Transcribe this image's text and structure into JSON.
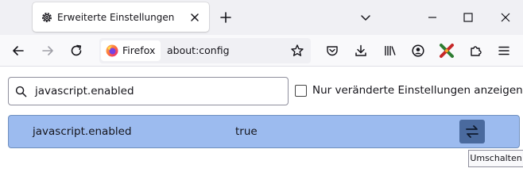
{
  "tab": {
    "title": "Erweiterte Einstellungen",
    "icon": "gear-icon"
  },
  "toolbar": {
    "identity_label": "Firefox",
    "url": "about:config",
    "buttons": [
      "back-icon",
      "forward-icon",
      "reload-icon",
      "bookmark-star-icon",
      "pocket-icon",
      "download-icon",
      "library-icon",
      "account-icon",
      "extension-icon",
      "puzzle-icon",
      "menu-icon"
    ]
  },
  "search": {
    "value": "javascript.enabled",
    "placeholder": ""
  },
  "filter": {
    "label": "Nur veränderte Einstellungen anzeigen",
    "checked": false
  },
  "preferences": [
    {
      "name": "javascript.enabled",
      "value": "true"
    }
  ],
  "tooltip": "Umschalten",
  "colors": {
    "row_highlight": "#9cbbef",
    "toggle_button": "#4a6a9e",
    "tabstrip": "#f0f0f4"
  }
}
